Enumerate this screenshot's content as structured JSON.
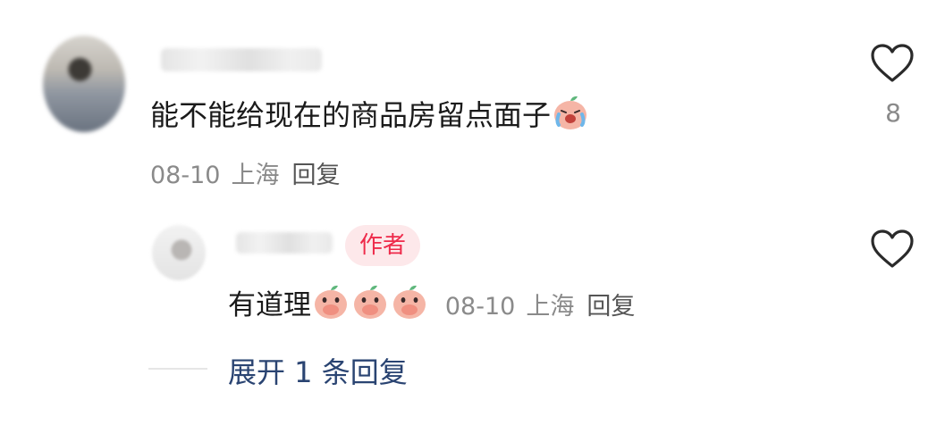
{
  "comment": {
    "text": "能不能给现在的商品房留点面子",
    "date": "08-10",
    "location": "上海",
    "reply_label": "回复",
    "like_count": "8"
  },
  "reply": {
    "author_badge": "作者",
    "text": "有道理",
    "date": "08-10",
    "location": "上海",
    "reply_label": "回复"
  },
  "expand": {
    "label": "展开 1 条回复"
  },
  "icons": {
    "like": "heart-outline-icon",
    "emoji_crying": "crying-peach-emoji-icon",
    "emoji_covering_mouth": "covering-mouth-peach-emoji-icon"
  },
  "colors": {
    "author_badge_text": "#ee2a4a",
    "author_badge_bg": "#fde8ea",
    "expand_link": "#2a4472",
    "meta_text": "#8a8a8a"
  }
}
